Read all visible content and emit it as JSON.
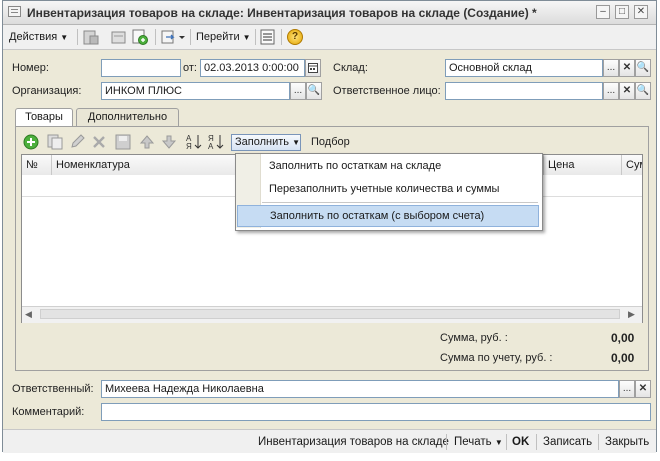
{
  "window": {
    "title": "Инвентаризация товаров на складе: Инвентаризация товаров на складе (Создание) *",
    "minimize_glyph": "–",
    "restore_glyph": "□",
    "close_glyph": "✕"
  },
  "toolbar": {
    "actions_label": "Действия",
    "goto_label": "Перейти",
    "help_glyph": "?"
  },
  "header": {
    "number_label": "Номер:",
    "number_value": "",
    "date_label": "от:",
    "date_value": "02.03.2013  0:00:00",
    "warehouse_label": "Склад:",
    "warehouse_value": "Основной склад",
    "org_label": "Организация:",
    "org_value": "ИНКОМ ПЛЮС",
    "responsible_person_label": "Ответственное лицо:",
    "responsible_person_value": ""
  },
  "tabs": [
    {
      "label": "Товары"
    },
    {
      "label": "Дополнительно"
    }
  ],
  "grid_toolbar": {
    "fill_label": "Заполнить",
    "selection_label": "Подбор"
  },
  "grid": {
    "columns": [
      "№",
      "Номенклатура",
      "Цена",
      "Сум"
    ]
  },
  "fill_menu": {
    "items": [
      {
        "label": "Заполнить по остаткам на складе"
      },
      {
        "label": "Перезаполнить учетные количества и суммы"
      },
      {
        "label": "Заполнить по остаткам (с выбором счета)"
      }
    ]
  },
  "totals": {
    "sum_label": "Сумма, руб. :",
    "sum_value": "0,00",
    "acct_sum_label": "Сумма по учету, руб. :",
    "acct_sum_value": "0,00"
  },
  "footer": {
    "responsible_label": "Ответственный:",
    "responsible_value": "Михеева Надежда Николаевна",
    "comment_label": "Комментарий:",
    "comment_value": ""
  },
  "bottom_bar": {
    "doc_label": "Инвентаризация товаров на складе",
    "print_label": "Печать",
    "ok_label": "OK",
    "save_label": "Записать",
    "close_label": "Закрыть"
  },
  "colors": {
    "window_bg": "#ece9d8",
    "menu_highlight": "#c6dcf3"
  }
}
